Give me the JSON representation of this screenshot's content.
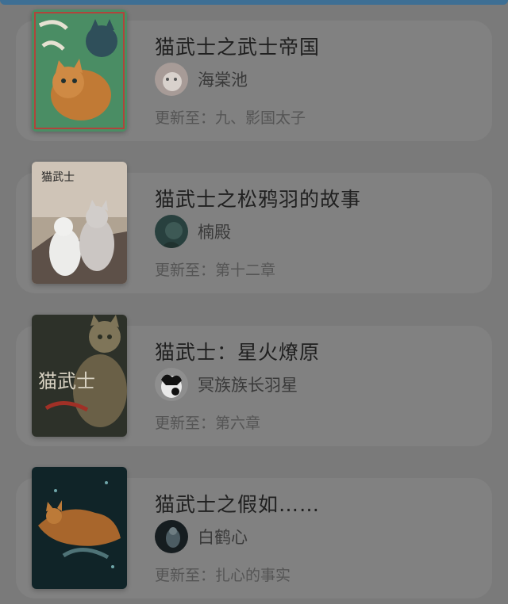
{
  "books": [
    {
      "title": "猫武士之武士帝国",
      "author": "海棠池",
      "update_prefix": "更新至：",
      "update_chapter": "九、影国太子",
      "cover_icon": "cover-warrior-empire"
    },
    {
      "title": "猫武士之松鸦羽的故事",
      "author": "楠殿",
      "update_prefix": "更新至：",
      "update_chapter": "第十二章",
      "cover_icon": "cover-jayfeather-story"
    },
    {
      "title": "猫武士：星火燎原",
      "author": "冥族族长羽星",
      "update_prefix": "更新至：",
      "update_chapter": "第六章",
      "cover_icon": "cover-starfire"
    },
    {
      "title": "猫武士之假如……",
      "author": "白鹤心",
      "update_prefix": "更新至：",
      "update_chapter": "扎心的事实",
      "cover_icon": "cover-what-if"
    }
  ],
  "colors": {
    "overlay_bg": "#7a7a7a",
    "card_bg": "#818181",
    "title_text": "#202020",
    "author_text": "#3a3a3a",
    "update_text": "#555555",
    "top_strip": "#3e6f94"
  }
}
